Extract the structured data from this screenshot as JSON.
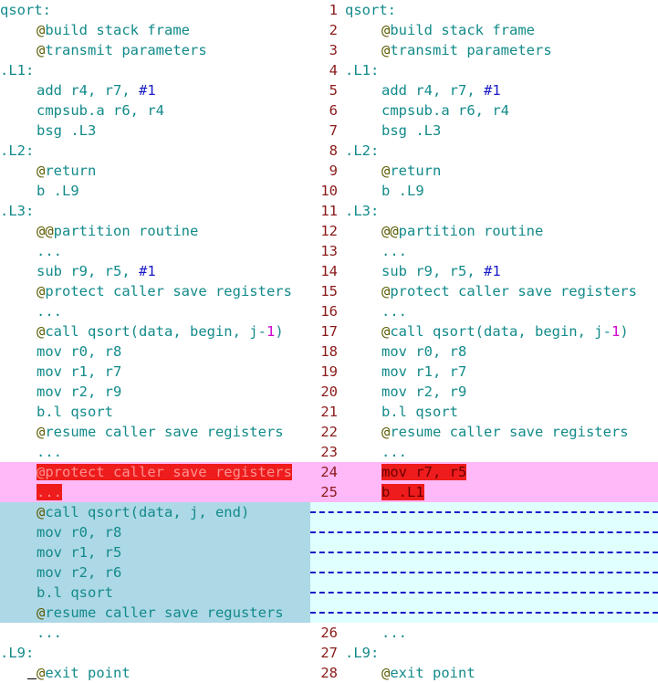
{
  "left": [
    {
      "text": "qsort:",
      "indent": false,
      "bg": ""
    },
    {
      "text": "@build stack frame",
      "indent": true,
      "bg": ""
    },
    {
      "text": "@transmit parameters",
      "indent": true,
      "bg": ""
    },
    {
      "text": ".L1:",
      "indent": false,
      "bg": ""
    },
    {
      "text": "add r4, r7, #1",
      "indent": true,
      "bg": ""
    },
    {
      "text": "cmpsub.a r6, r4",
      "indent": true,
      "bg": ""
    },
    {
      "text": "bsg .L3",
      "indent": true,
      "bg": ""
    },
    {
      "text": ".L2:",
      "indent": false,
      "bg": ""
    },
    {
      "text": "@return",
      "indent": true,
      "bg": ""
    },
    {
      "text": "b .L9",
      "indent": true,
      "bg": ""
    },
    {
      "text": ".L3:",
      "indent": false,
      "bg": ""
    },
    {
      "text": "@@partition routine",
      "indent": true,
      "bg": ""
    },
    {
      "text": "...",
      "indent": true,
      "bg": ""
    },
    {
      "text": "sub r9, r5, #1",
      "indent": true,
      "bg": ""
    },
    {
      "text": "@protect caller save registers",
      "indent": true,
      "bg": ""
    },
    {
      "text": "...",
      "indent": true,
      "bg": ""
    },
    {
      "text": "@call qsort(data, begin, j-1)",
      "indent": true,
      "bg": ""
    },
    {
      "text": "mov r0, r8",
      "indent": true,
      "bg": ""
    },
    {
      "text": "mov r1, r7",
      "indent": true,
      "bg": ""
    },
    {
      "text": "mov r2, r9",
      "indent": true,
      "bg": ""
    },
    {
      "text": "b.l qsort",
      "indent": true,
      "bg": ""
    },
    {
      "text": "@resume caller save registers",
      "indent": true,
      "bg": ""
    },
    {
      "text": "...",
      "indent": true,
      "bg": ""
    },
    {
      "text": "@protect caller save registers",
      "indent": true,
      "bg": "del",
      "hl": true
    },
    {
      "text": "...",
      "indent": true,
      "bg": "del",
      "hl": true
    },
    {
      "text": "@call qsort(data, j, end)",
      "indent": true,
      "bg": "chg"
    },
    {
      "text": "mov r0, r8",
      "indent": true,
      "bg": "chg"
    },
    {
      "text": "mov r1, r5",
      "indent": true,
      "bg": "chg"
    },
    {
      "text": "mov r2, r6",
      "indent": true,
      "bg": "chg"
    },
    {
      "text": "b.l qsort",
      "indent": true,
      "bg": "chg"
    },
    {
      "text": "@resume caller save regusters",
      "indent": true,
      "bg": "chg"
    },
    {
      "text": "...",
      "indent": true,
      "bg": ""
    },
    {
      "text": ".L9:",
      "indent": false,
      "bg": ""
    },
    {
      "text": "@exit point",
      "indent": true,
      "bg": "",
      "cursor": true
    }
  ],
  "right": [
    {
      "num": "1",
      "text": "qsort:",
      "indent": false,
      "bg": ""
    },
    {
      "num": "2",
      "text": "@build stack frame",
      "indent": true,
      "bg": ""
    },
    {
      "num": "3",
      "text": "@transmit parameters",
      "indent": true,
      "bg": ""
    },
    {
      "num": "4",
      "text": ".L1:",
      "indent": false,
      "bg": ""
    },
    {
      "num": "5",
      "text": "add r4, r7, #1",
      "indent": true,
      "bg": ""
    },
    {
      "num": "6",
      "text": "cmpsub.a r6, r4",
      "indent": true,
      "bg": ""
    },
    {
      "num": "7",
      "text": "bsg .L3",
      "indent": true,
      "bg": ""
    },
    {
      "num": "8",
      "text": ".L2:",
      "indent": false,
      "bg": ""
    },
    {
      "num": "9",
      "text": "@return",
      "indent": true,
      "bg": ""
    },
    {
      "num": "10",
      "text": "b .L9",
      "indent": true,
      "bg": ""
    },
    {
      "num": "11",
      "text": ".L3:",
      "indent": false,
      "bg": ""
    },
    {
      "num": "12",
      "text": "@@partition routine",
      "indent": true,
      "bg": ""
    },
    {
      "num": "13",
      "text": "...",
      "indent": true,
      "bg": ""
    },
    {
      "num": "14",
      "text": "sub r9, r5, #1",
      "indent": true,
      "bg": ""
    },
    {
      "num": "15",
      "text": "@protect caller save registers",
      "indent": true,
      "bg": ""
    },
    {
      "num": "16",
      "text": "...",
      "indent": true,
      "bg": ""
    },
    {
      "num": "17",
      "text": "@call qsort(data, begin, j-1)",
      "indent": true,
      "bg": ""
    },
    {
      "num": "18",
      "text": "mov r0, r8",
      "indent": true,
      "bg": ""
    },
    {
      "num": "19",
      "text": "mov r1, r7",
      "indent": true,
      "bg": ""
    },
    {
      "num": "20",
      "text": "mov r2, r9",
      "indent": true,
      "bg": ""
    },
    {
      "num": "21",
      "text": "b.l qsort",
      "indent": true,
      "bg": ""
    },
    {
      "num": "22",
      "text": "@resume caller save registers",
      "indent": true,
      "bg": ""
    },
    {
      "num": "23",
      "text": "...",
      "indent": true,
      "bg": ""
    },
    {
      "num": "24",
      "text": "mov r7, r5",
      "indent": true,
      "bg": "del",
      "hl": true
    },
    {
      "num": "25",
      "text": "b .L1",
      "indent": true,
      "bg": "del",
      "hl": true
    },
    {
      "num": "",
      "text": "",
      "indent": false,
      "bg": "add",
      "dash": true
    },
    {
      "num": "",
      "text": "",
      "indent": false,
      "bg": "add",
      "dash": true
    },
    {
      "num": "",
      "text": "",
      "indent": false,
      "bg": "add",
      "dash": true
    },
    {
      "num": "",
      "text": "",
      "indent": false,
      "bg": "add",
      "dash": true
    },
    {
      "num": "",
      "text": "",
      "indent": false,
      "bg": "add",
      "dash": true
    },
    {
      "num": "",
      "text": "",
      "indent": false,
      "bg": "add",
      "dash": true
    },
    {
      "num": "26",
      "text": "...",
      "indent": true,
      "bg": ""
    },
    {
      "num": "27",
      "text": ".L9:",
      "indent": false,
      "bg": ""
    },
    {
      "num": "28",
      "text": "@exit point",
      "indent": true,
      "bg": ""
    }
  ],
  "colors": {
    "deleted": "#ffb8f8",
    "changed": "#add8e6",
    "added": "#e0ffff",
    "highlight": "#ee1c1c",
    "line_number": "#8b1a1a",
    "code": "#138a8a"
  }
}
